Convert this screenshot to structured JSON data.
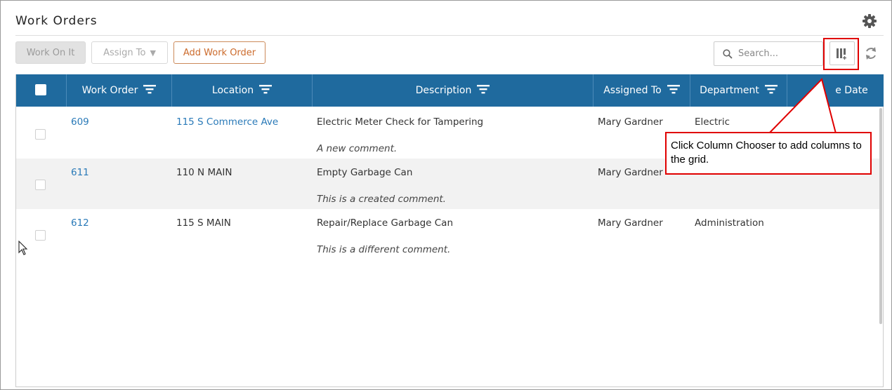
{
  "page": {
    "title": "Work Orders"
  },
  "toolbar": {
    "work_on_it": "Work On It",
    "assign_to": "Assign To",
    "add_work_order": "Add Work Order",
    "search_placeholder": "Search..."
  },
  "grid": {
    "columns": [
      {
        "label": "Work Order"
      },
      {
        "label": "Location"
      },
      {
        "label": "Description"
      },
      {
        "label": "Assigned To"
      },
      {
        "label": "Department"
      },
      {
        "label": "e Date"
      }
    ],
    "rows": [
      {
        "work_order": "609",
        "location": "115 S Commerce Ave",
        "description": "Electric Meter Check for Tampering",
        "comment": "A new comment.",
        "assigned_to": "Mary Gardner",
        "department": "Electric"
      },
      {
        "work_order": "611",
        "location": "110 N MAIN",
        "description": "Empty Garbage Can",
        "comment": "This is a created comment.",
        "assigned_to": "Mary Gardner",
        "department": ""
      },
      {
        "work_order": "612",
        "location": "115 S MAIN",
        "description": "Repair/Replace Garbage Can",
        "comment": "This is a different comment.",
        "assigned_to": "Mary Gardner",
        "department": "Administration"
      }
    ]
  },
  "callout": {
    "text": "Click Column Chooser to add columns to the grid."
  },
  "colors": {
    "header_bg": "#1f6a9e",
    "link": "#2a7ab8",
    "accent": "#cc6b2c",
    "highlight": "#e00000"
  },
  "icons": [
    "gear-icon",
    "search-icon",
    "column-chooser-icon",
    "refresh-icon",
    "filter-icon",
    "caret-down-icon",
    "mouse-cursor-icon"
  ]
}
